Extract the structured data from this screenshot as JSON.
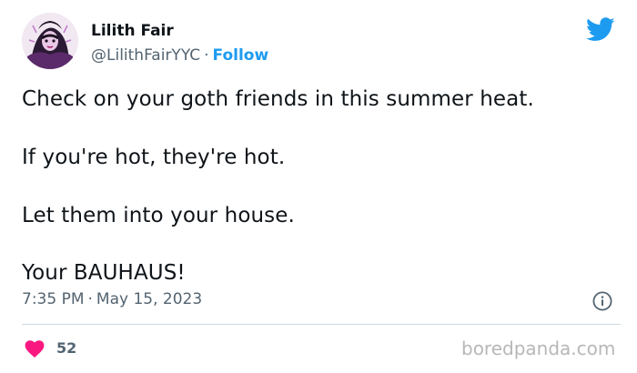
{
  "author": {
    "display_name": "Lilith Fair",
    "handle": "@LilithFairYYC",
    "separator": "·",
    "follow_label": "Follow"
  },
  "tweet": {
    "lines": [
      "Check on your goth friends in this summer heat.",
      "If you're hot, they're hot.",
      "Let them into your house.",
      "Your BAUHAUS!"
    ]
  },
  "meta": {
    "time": "7:35 PM",
    "separator": "·",
    "date": "May 15, 2023"
  },
  "engagement": {
    "likes": "52"
  },
  "watermark": "boredpanda.com",
  "colors": {
    "twitter_blue": "#1d9bf0",
    "heart": "#f91880",
    "secondary_text": "#536471"
  },
  "icons": [
    "twitter-bird-icon",
    "info-icon",
    "heart-icon"
  ]
}
